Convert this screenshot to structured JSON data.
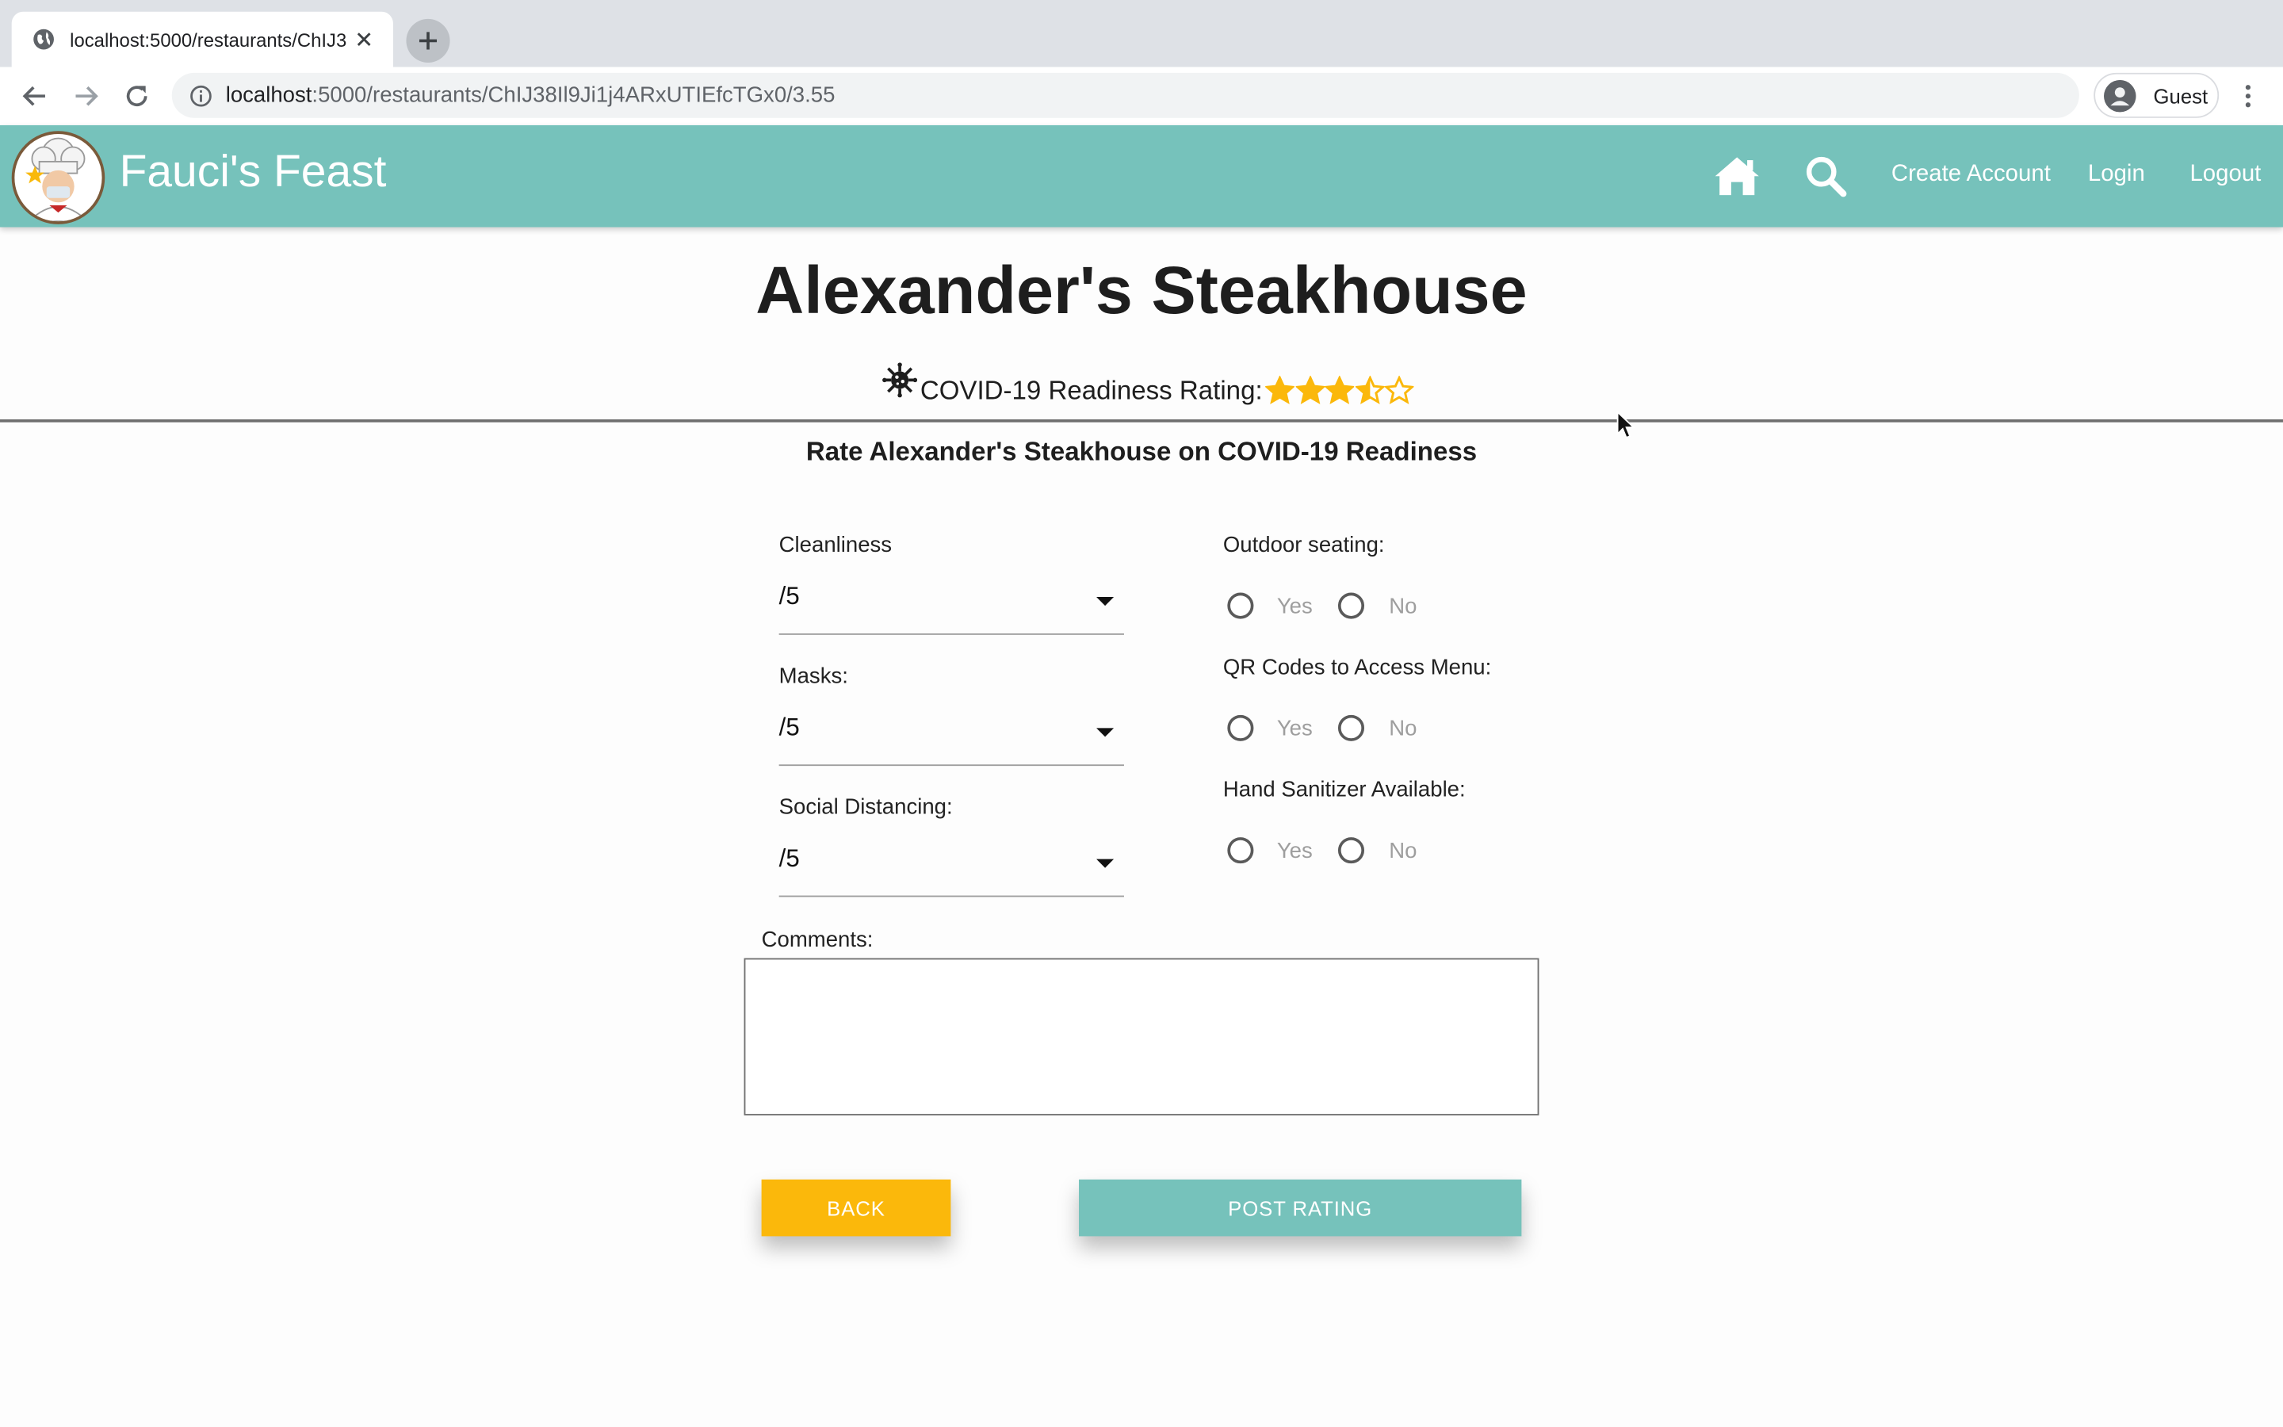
{
  "browser": {
    "tab_title": "localhost:5000/restaurants/ChIJ38Il9Ji1j4ARxUTIEfcTGx0/3.55",
    "url_host": "localhost",
    "url_path": ":5000/restaurants/ChIJ38Il9Ji1j4ARxUTIEfcTGx0/3.55",
    "profile_label": "Guest"
  },
  "header": {
    "brand": "Fauci's Feast",
    "nav": {
      "create_account": "Create Account",
      "login": "Login",
      "logout": "Logout"
    },
    "color": "#76c2bb"
  },
  "restaurant": {
    "name": "Alexander's Steakhouse",
    "rating_label": "COVID-19 Readiness Rating:",
    "rating_value": 3.5,
    "rating_max": 5
  },
  "form": {
    "title": "Rate Alexander's Steakhouse on COVID-19 Readiness",
    "selects": [
      {
        "label": "Cleanliness",
        "value": "/5"
      },
      {
        "label": "Masks:",
        "value": "/5"
      },
      {
        "label": "Social Distancing:",
        "value": "/5"
      }
    ],
    "radios": [
      {
        "label": "Outdoor seating:",
        "yes": "Yes",
        "no": "No"
      },
      {
        "label": "QR Codes to Access Menu:",
        "yes": "Yes",
        "no": "No"
      },
      {
        "label": "Hand Sanitizer Available:",
        "yes": "Yes",
        "no": "No"
      }
    ],
    "comments_label": "Comments:",
    "back_label": "BACK",
    "post_label": "POST RATING"
  },
  "colors": {
    "accent": "#76c2bb",
    "back_button": "#fbb80b",
    "star": "#fbb80b"
  }
}
